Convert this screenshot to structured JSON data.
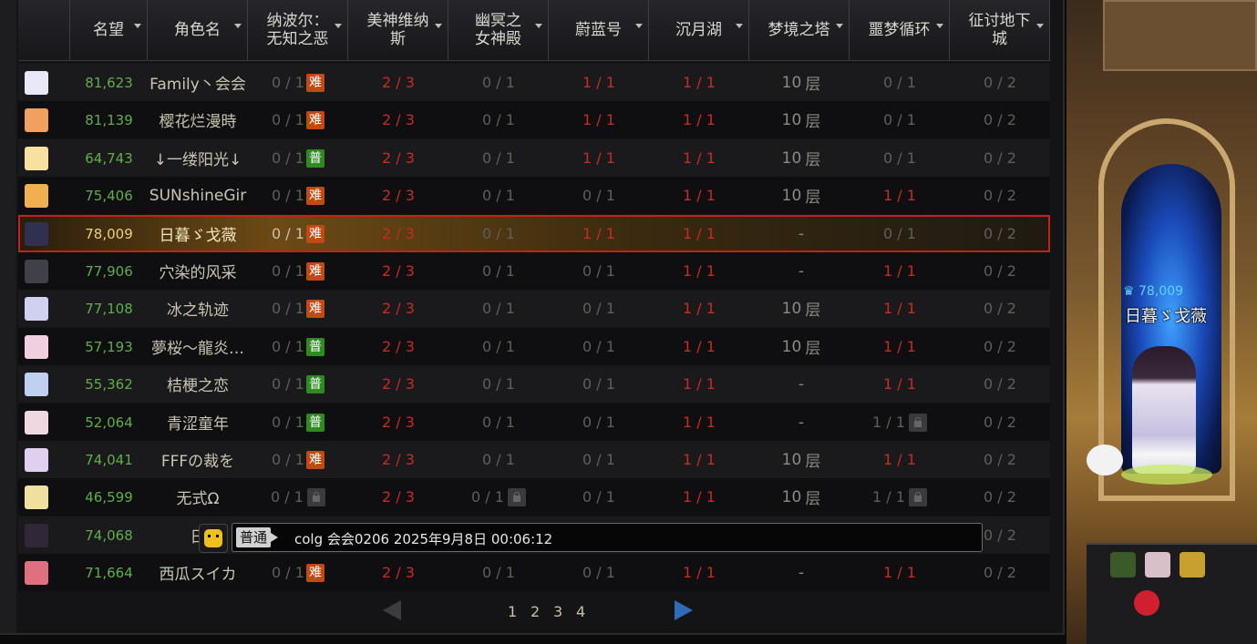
{
  "columns": [
    {
      "label": "名望"
    },
    {
      "label": "角色名"
    },
    {
      "label": "纳波尔：\n无知之恶"
    },
    {
      "label": "美神维纳\n斯"
    },
    {
      "label": "幽冥之\n女神殿"
    },
    {
      "label": "蔚蓝号"
    },
    {
      "label": "沉月湖"
    },
    {
      "label": "梦境之塔"
    },
    {
      "label": "噩梦循环"
    },
    {
      "label": "征讨地下\n城"
    }
  ],
  "rows": [
    {
      "fame": "81,623",
      "name": "Family丶会会",
      "c1": "0 / 1",
      "c1b": "难",
      "c1t": "hard",
      "c2": "2 / 3",
      "c3": "0 / 1",
      "c3t": "",
      "c4": "1 / 1",
      "c4r": true,
      "c5": "1 / 1",
      "c6": "10",
      "c7": "0 / 1",
      "c7r": false,
      "c7lock": false,
      "c8": "0 / 2",
      "av": "#e8e8f8"
    },
    {
      "fame": "81,139",
      "name": "樱花烂漫時",
      "c1": "0 / 1",
      "c1b": "难",
      "c1t": "hard",
      "c2": "2 / 3",
      "c3": "0 / 1",
      "c3t": "",
      "c4": "1 / 1",
      "c4r": true,
      "c5": "1 / 1",
      "c6": "10",
      "c7": "0 / 1",
      "c7r": false,
      "c7lock": false,
      "c8": "0 / 2",
      "av": "#f0a060"
    },
    {
      "fame": "64,743",
      "name": "↓一缕阳光↓",
      "c1": "0 / 1",
      "c1b": "普",
      "c1t": "normal",
      "c2": "2 / 3",
      "c3": "0 / 1",
      "c3t": "",
      "c4": "1 / 1",
      "c4r": true,
      "c5": "1 / 1",
      "c6": "10",
      "c7": "0 / 1",
      "c7r": false,
      "c7lock": false,
      "c8": "0 / 2",
      "av": "#f8e0a0"
    },
    {
      "fame": "75,406",
      "name": "SUNshineGir",
      "c1": "0 / 1",
      "c1b": "难",
      "c1t": "hard",
      "c2": "2 / 3",
      "c3": "0 / 1",
      "c3t": "",
      "c4": "0 / 1",
      "c4r": false,
      "c5": "1 / 1",
      "c6": "10",
      "c7": "1 / 1",
      "c7r": true,
      "c7lock": false,
      "c8": "0 / 2",
      "av": "#f0b050"
    },
    {
      "fame": "78,009",
      "name": "日暮ゞ戈薇",
      "c1": "0 / 1",
      "c1b": "难",
      "c1t": "hard",
      "c2": "2 / 3",
      "c3": "0 / 1",
      "c3t": "",
      "c4": "1 / 1",
      "c4r": true,
      "c5": "1 / 1",
      "c6": "-",
      "c7": "0 / 1",
      "c7r": false,
      "c7lock": false,
      "c8": "0 / 2",
      "av": "#303050",
      "sel": true
    },
    {
      "fame": "77,906",
      "name": "穴染的风采",
      "c1": "0 / 1",
      "c1b": "难",
      "c1t": "hard",
      "c2": "2 / 3",
      "c3": "0 / 1",
      "c3t": "",
      "c4": "0 / 1",
      "c4r": false,
      "c5": "1 / 1",
      "c6": "-",
      "c7": "1 / 1",
      "c7r": true,
      "c7lock": false,
      "c8": "0 / 2",
      "av": "#404048"
    },
    {
      "fame": "77,108",
      "name": "冰之轨迹",
      "c1": "0 / 1",
      "c1b": "难",
      "c1t": "hard",
      "c2": "2 / 3",
      "c3": "0 / 1",
      "c3t": "",
      "c4": "0 / 1",
      "c4r": false,
      "c5": "1 / 1",
      "c6": "10",
      "c7": "1 / 1",
      "c7r": true,
      "c7lock": false,
      "c8": "0 / 2",
      "av": "#d0d0f0"
    },
    {
      "fame": "57,193",
      "name": "夢桜～龍炎…",
      "c1": "0 / 1",
      "c1b": "普",
      "c1t": "normal",
      "c2": "2 / 3",
      "c3": "0 / 1",
      "c3t": "",
      "c4": "0 / 1",
      "c4r": false,
      "c5": "1 / 1",
      "c6": "10",
      "c7": "1 / 1",
      "c7r": true,
      "c7lock": false,
      "c8": "0 / 2",
      "av": "#f0d0e0"
    },
    {
      "fame": "55,362",
      "name": "桔梗之恋",
      "c1": "0 / 1",
      "c1b": "普",
      "c1t": "normal",
      "c2": "2 / 3",
      "c3": "0 / 1",
      "c3t": "",
      "c4": "0 / 1",
      "c4r": false,
      "c5": "1 / 1",
      "c6": "-",
      "c7": "1 / 1",
      "c7r": true,
      "c7lock": false,
      "c8": "0 / 2",
      "av": "#c0d0f0"
    },
    {
      "fame": "52,064",
      "name": "青涩童年",
      "c1": "0 / 1",
      "c1b": "普",
      "c1t": "normal",
      "c2": "2 / 3",
      "c3": "0 / 1",
      "c3t": "",
      "c4": "0 / 1",
      "c4r": false,
      "c5": "1 / 1",
      "c6": "-",
      "c7": "1 / 1",
      "c7r": false,
      "c7lock": true,
      "c8": "0 / 2",
      "av": "#f0d8e0"
    },
    {
      "fame": "74,041",
      "name": "FFFの裁を",
      "c1": "0 / 1",
      "c1b": "难",
      "c1t": "hard",
      "c2": "2 / 3",
      "c3": "0 / 1",
      "c3t": "",
      "c4": "0 / 1",
      "c4r": false,
      "c5": "1 / 1",
      "c6": "10",
      "c7": "1 / 1",
      "c7r": true,
      "c7lock": false,
      "c8": "0 / 2",
      "av": "#e0d0f0"
    },
    {
      "fame": "46,599",
      "name": "无式Ω",
      "c1": "0 / 1",
      "c1b": "",
      "c1t": "lock",
      "c2": "2 / 3",
      "c3": "0 / 1",
      "c3t": "lock",
      "c4": "0 / 1",
      "c4r": false,
      "c5": "1 / 1",
      "c6": "10",
      "c7": "1 / 1",
      "c7r": false,
      "c7lock": true,
      "c8": "0 / 2",
      "av": "#f0e0a0"
    },
    {
      "fame": "74,068",
      "name": "日",
      "c1": "",
      "c1b": "",
      "c1t": "none",
      "c2": "",
      "c3": "",
      "c3t": "",
      "c4": "",
      "c4r": false,
      "c5": "",
      "c6": "",
      "c7": "",
      "c7r": false,
      "c7lock": false,
      "c8": "0 / 2",
      "av": "#302838"
    },
    {
      "fame": "71,664",
      "name": "西瓜スイカ",
      "c1": "0 / 1",
      "c1b": "难",
      "c1t": "hard",
      "c2": "2 / 3",
      "c3": "0 / 1",
      "c3t": "",
      "c4": "0 / 1",
      "c4r": false,
      "c5": "1 / 1",
      "c6": "-",
      "c7": "1 / 1",
      "c7r": true,
      "c7lock": false,
      "c8": "0 / 2",
      "av": "#e07080"
    }
  ],
  "floor_unit": "层",
  "pager": {
    "pages": [
      "1",
      "2",
      "3",
      "4"
    ]
  },
  "chat": {
    "channel": "普通",
    "text": "colg 会会0206  2025年9月8日  00:06:12"
  },
  "player": {
    "fame": "78,009",
    "name": "日暮ゞ戈薇"
  },
  "colors": {
    "red": "#c82a24",
    "green": "#5fae4a",
    "accent_blue": "#2f6bb8",
    "selected_border": "#c42020"
  }
}
